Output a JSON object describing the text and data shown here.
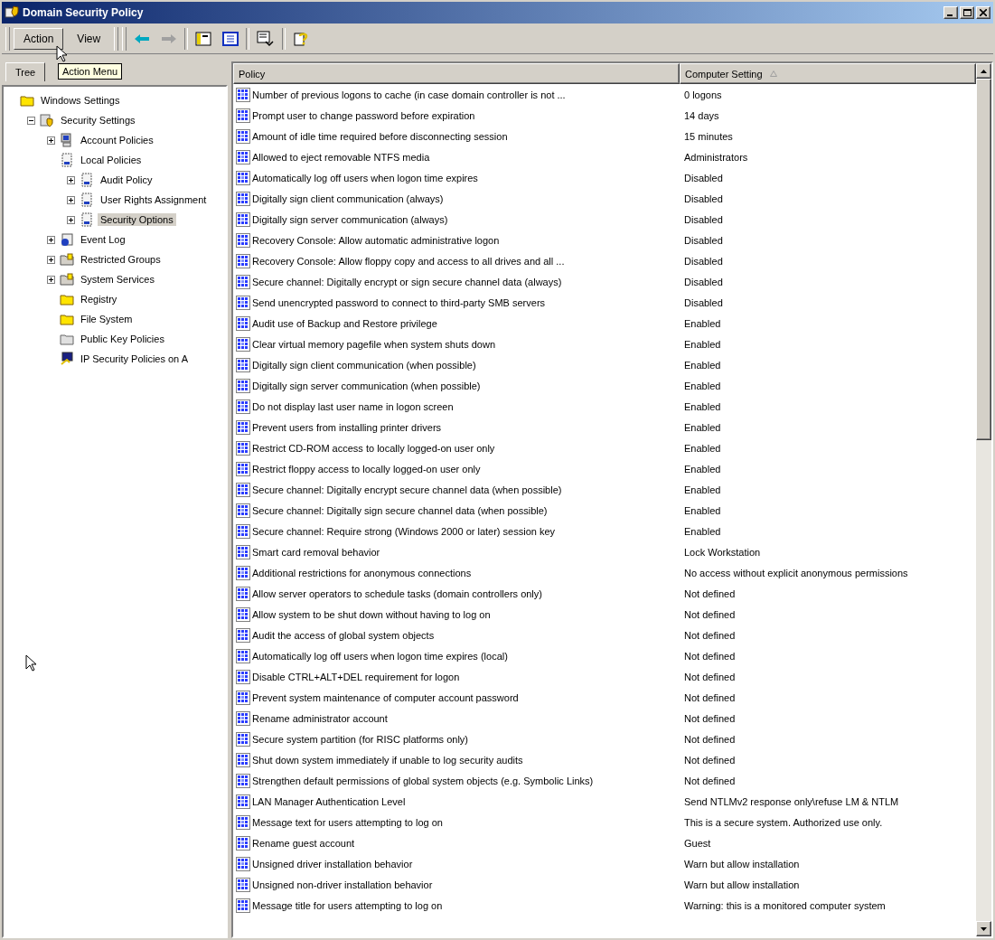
{
  "window": {
    "title": "Domain Security Policy"
  },
  "toolbar": {
    "menus": [
      {
        "label": "Action"
      },
      {
        "label": "View"
      }
    ],
    "buttons": [
      {
        "kind": "back",
        "disabled": false
      },
      {
        "kind": "forward",
        "disabled": true
      },
      {
        "kind": "tree"
      },
      {
        "kind": "properties"
      },
      {
        "kind": "export"
      },
      {
        "kind": "help"
      }
    ],
    "tooltip": "Action Menu"
  },
  "left_pane": {
    "tabs": [
      {
        "label": "Tree",
        "selected": true
      }
    ],
    "tree": [
      {
        "label": "Windows Settings",
        "kind": "folder",
        "selected": false,
        "children": [
          {
            "label": "Security Settings",
            "kind": "security",
            "expanded": true,
            "selected": false,
            "children": [
              {
                "label": "Account Policies",
                "kind": "computer",
                "expanded": false,
                "selected": false
              },
              {
                "label": "Local Policies",
                "kind": "policy",
                "selected": false,
                "children": [
                  {
                    "label": "Audit Policy",
                    "kind": "policy",
                    "expanded": false,
                    "selected": false
                  },
                  {
                    "label": "User Rights Assignment",
                    "kind": "policy",
                    "expanded": false,
                    "selected": false
                  },
                  {
                    "label": "Security Options",
                    "kind": "policy",
                    "expanded": false,
                    "selected": true
                  }
                ]
              },
              {
                "label": "Event Log",
                "kind": "event",
                "expanded": false,
                "selected": false
              },
              {
                "label": "Restricted Groups",
                "kind": "group",
                "expanded": false,
                "selected": false
              },
              {
                "label": "System Services",
                "kind": "group",
                "expanded": false,
                "selected": false
              },
              {
                "label": "Registry",
                "kind": "folder",
                "selected": false
              },
              {
                "label": "File System",
                "kind": "folder",
                "selected": false
              },
              {
                "label": "Public Key Policies",
                "kind": "plain",
                "selected": false
              },
              {
                "label": "IP Security Policies on A",
                "kind": "ip",
                "selected": false
              }
            ]
          }
        ]
      }
    ]
  },
  "table": {
    "columns": [
      {
        "label": "Policy",
        "sorted": false
      },
      {
        "label": "Computer Setting",
        "sorted": true
      }
    ],
    "rows": [
      {
        "policy": "Number of previous logons to cache (in case domain controller is not ...",
        "setting": "0 logons"
      },
      {
        "policy": "Prompt user to change password before expiration",
        "setting": "14 days"
      },
      {
        "policy": "Amount of idle time required before disconnecting session",
        "setting": "15 minutes"
      },
      {
        "policy": "Allowed to eject removable NTFS media",
        "setting": "Administrators"
      },
      {
        "policy": "Automatically log off users when logon time expires",
        "setting": "Disabled"
      },
      {
        "policy": "Digitally sign client communication (always)",
        "setting": "Disabled"
      },
      {
        "policy": "Digitally sign server communication (always)",
        "setting": "Disabled"
      },
      {
        "policy": "Recovery Console: Allow automatic administrative logon",
        "setting": "Disabled"
      },
      {
        "policy": "Recovery Console: Allow floppy copy and access to all drives and all ...",
        "setting": "Disabled"
      },
      {
        "policy": "Secure channel: Digitally encrypt or sign secure channel data (always)",
        "setting": "Disabled"
      },
      {
        "policy": "Send unencrypted password to connect to third-party SMB servers",
        "setting": "Disabled"
      },
      {
        "policy": "Audit use of Backup and Restore privilege",
        "setting": "Enabled"
      },
      {
        "policy": "Clear virtual memory pagefile when system shuts down",
        "setting": "Enabled"
      },
      {
        "policy": "Digitally sign client communication (when possible)",
        "setting": "Enabled"
      },
      {
        "policy": "Digitally sign server communication (when possible)",
        "setting": "Enabled"
      },
      {
        "policy": "Do not display last user name in logon screen",
        "setting": "Enabled"
      },
      {
        "policy": "Prevent users from installing printer drivers",
        "setting": "Enabled"
      },
      {
        "policy": "Restrict CD-ROM access to locally logged-on user only",
        "setting": "Enabled"
      },
      {
        "policy": "Restrict floppy access to locally logged-on user only",
        "setting": "Enabled"
      },
      {
        "policy": "Secure channel: Digitally encrypt secure channel data (when possible)",
        "setting": "Enabled"
      },
      {
        "policy": "Secure channel: Digitally sign secure channel data (when possible)",
        "setting": "Enabled"
      },
      {
        "policy": "Secure channel: Require strong (Windows 2000 or later) session key",
        "setting": "Enabled"
      },
      {
        "policy": "Smart card removal behavior",
        "setting": "Lock Workstation"
      },
      {
        "policy": "Additional restrictions for anonymous connections",
        "setting": "No access without explicit anonymous permissions"
      },
      {
        "policy": "Allow server operators to schedule tasks (domain controllers only)",
        "setting": "Not defined"
      },
      {
        "policy": "Allow system to be shut down without having to log on",
        "setting": "Not defined"
      },
      {
        "policy": "Audit the access of global system objects",
        "setting": "Not defined"
      },
      {
        "policy": "Automatically log off users when logon time expires (local)",
        "setting": "Not defined"
      },
      {
        "policy": "Disable CTRL+ALT+DEL requirement for logon",
        "setting": "Not defined"
      },
      {
        "policy": "Prevent system maintenance of computer account password",
        "setting": "Not defined"
      },
      {
        "policy": "Rename administrator account",
        "setting": "Not defined"
      },
      {
        "policy": "Secure system partition (for RISC platforms only)",
        "setting": "Not defined"
      },
      {
        "policy": "Shut down system immediately if unable to log security audits",
        "setting": "Not defined"
      },
      {
        "policy": "Strengthen default permissions of global system objects (e.g. Symbolic Links)",
        "setting": "Not defined"
      },
      {
        "policy": "LAN Manager Authentication Level",
        "setting": "Send NTLMv2 response only\\refuse LM & NTLM"
      },
      {
        "policy": "Message text for users attempting to log on",
        "setting": "This is a secure system. Authorized use only."
      },
      {
        "policy": "Rename guest account",
        "setting": "Guest"
      },
      {
        "policy": "Unsigned driver installation behavior",
        "setting": "Warn but allow installation"
      },
      {
        "policy": "Unsigned non-driver installation behavior",
        "setting": "Warn but allow installation"
      },
      {
        "policy": "Message title for users attempting to log on",
        "setting": "Warning: this is a monitored computer system"
      }
    ]
  }
}
